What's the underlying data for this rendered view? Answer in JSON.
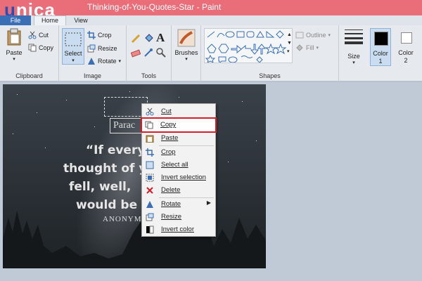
{
  "titlebar": {
    "logo_part1": "u",
    "logo_part2": "nica",
    "title": "Thinking-of-You-Quotes-Star - Paint"
  },
  "tabs": [
    {
      "label": "File"
    },
    {
      "label": "Home"
    },
    {
      "label": "View"
    }
  ],
  "ribbon": {
    "clipboard": {
      "paste": "Paste",
      "cut": "Cut",
      "copy": "Copy",
      "group": "Clipboard"
    },
    "image": {
      "select": "Select",
      "crop": "Crop",
      "resize": "Resize",
      "rotate": "Rotate",
      "group": "Image"
    },
    "tools": {
      "group": "Tools"
    },
    "brushes": {
      "label": "Brushes"
    },
    "shapes": {
      "outline": "Outline",
      "fill": "Fill",
      "group": "Shapes"
    },
    "size": {
      "label": "Size"
    },
    "color1": {
      "label": "Color",
      "number": "1"
    },
    "color2": {
      "label": "Color",
      "number": "2"
    }
  },
  "canvas": {
    "para_text": "Parac",
    "quote_lines": [
      "“If every",
      "thought of y",
      "fell, well,",
      "would be c"
    ],
    "attribution": "ANONYM"
  },
  "context_menu": {
    "items": [
      {
        "label": "Cut",
        "icon": "scissors-icon"
      },
      {
        "label": "Copy",
        "icon": "copy-icon"
      },
      {
        "label": "Paste",
        "icon": "paste-icon"
      },
      {
        "label": "Crop",
        "icon": "crop-icon"
      },
      {
        "label": "Select all",
        "icon": "select-all-icon"
      },
      {
        "label": "Invert selection",
        "icon": "invert-selection-icon"
      },
      {
        "label": "Delete",
        "icon": "delete-icon"
      },
      {
        "label": "Rotate",
        "icon": "rotate-icon"
      },
      {
        "label": "Resize",
        "icon": "resize-icon"
      },
      {
        "label": "Invert color",
        "icon": "invert-color-icon"
      }
    ]
  },
  "colors": {
    "titlebar": "#e96e7a",
    "file_tab": "#3b6fb5",
    "highlight": "#d41f2a"
  }
}
